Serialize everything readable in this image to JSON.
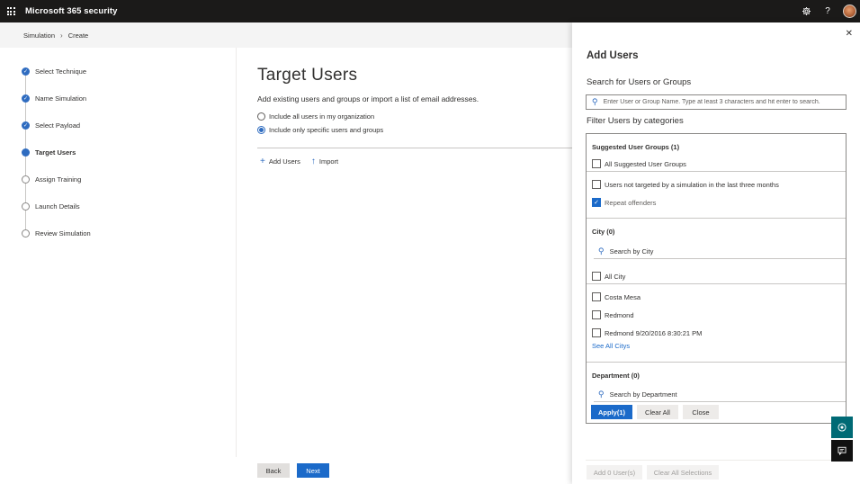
{
  "header": {
    "app_title": "Microsoft 365 security"
  },
  "breadcrumb": [
    "Simulation",
    "Create"
  ],
  "steps": [
    {
      "label": "Select Technique",
      "state": "done"
    },
    {
      "label": "Name Simulation",
      "state": "done"
    },
    {
      "label": "Select Payload",
      "state": "done"
    },
    {
      "label": "Target Users",
      "state": "current"
    },
    {
      "label": "Assign Training",
      "state": "todo"
    },
    {
      "label": "Launch Details",
      "state": "todo"
    },
    {
      "label": "Review Simulation",
      "state": "todo"
    }
  ],
  "main": {
    "title": "Target Users",
    "subtitle": "Add existing users and groups or import a list of email addresses.",
    "radio_all": "Include all users in my organization",
    "radio_specific": "Include only specific users and groups",
    "add_users": "Add Users",
    "import": "Import",
    "back": "Back",
    "next": "Next"
  },
  "panel": {
    "title": "Add Users",
    "search_heading": "Search for Users or Groups",
    "search_placeholder": "Enter User or Group Name. Type at least 3 characters and hit enter to search.",
    "filter_heading": "Filter Users by categories",
    "suggested_heading": "Suggested User Groups (1)",
    "suggested_all": "All Suggested User Groups",
    "suggested_not_targeted": "Users not targeted by a simulation in the last three months",
    "suggested_repeat": "Repeat offenders",
    "city_heading": "City (0)",
    "city_search_placeholder": "Search by City",
    "city_all": "All City",
    "city_1": "Costa Mesa",
    "city_2": "Redmond",
    "city_3": "Redmond 9/20/2016 8:30:21 PM",
    "city_see_all": "See All Citys",
    "dept_heading": "Department (0)",
    "dept_search_placeholder": "Search by Department",
    "apply": "Apply(1)",
    "clear_all": "Clear All",
    "close": "Close",
    "add_selected": "Add 0 User(s)",
    "clear_selections": "Clear All Selections"
  },
  "colors": {
    "accent": "#1b6ac9",
    "topbar": "#1b1a19",
    "fab": "#006a75"
  }
}
